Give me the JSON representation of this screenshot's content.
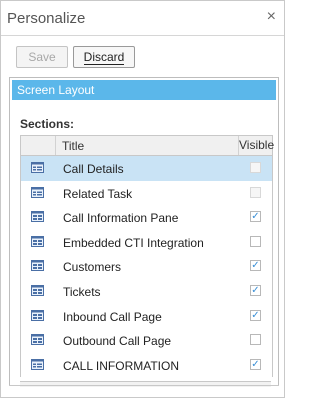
{
  "header": {
    "title": "Personalize",
    "close_glyph": "×"
  },
  "toolbar": {
    "save_label": "Save",
    "discard_label": "Discard"
  },
  "screen_layout": {
    "label": "Screen Layout"
  },
  "sections": {
    "label": "Sections:",
    "columns": {
      "title": "Title",
      "visible": "Visible"
    },
    "rows": [
      {
        "title": "Call Details",
        "icon": "single-panel-icon",
        "checked": false,
        "enabled": false,
        "selected": true
      },
      {
        "title": "Related Task",
        "icon": "single-panel-icon",
        "checked": false,
        "enabled": false,
        "selected": false
      },
      {
        "title": "Call Information Pane",
        "icon": "grid-panel-icon",
        "checked": true,
        "enabled": true,
        "selected": false
      },
      {
        "title": "Embedded CTI Integration",
        "icon": "grid-panel-icon",
        "checked": false,
        "enabled": true,
        "selected": false
      },
      {
        "title": "Customers",
        "icon": "grid-panel-icon",
        "checked": true,
        "enabled": true,
        "selected": false
      },
      {
        "title": "Tickets",
        "icon": "grid-panel-icon",
        "checked": true,
        "enabled": true,
        "selected": false
      },
      {
        "title": "Inbound Call Page",
        "icon": "grid-panel-icon",
        "checked": true,
        "enabled": true,
        "selected": false
      },
      {
        "title": "Outbound Call Page",
        "icon": "grid-panel-icon",
        "checked": false,
        "enabled": true,
        "selected": false
      },
      {
        "title": "CALL INFORMATION",
        "icon": "single-panel-icon",
        "checked": true,
        "enabled": true,
        "selected": false
      }
    ]
  },
  "colors": {
    "accent": "#5bb7ea",
    "selected_row": "#c9e3f5",
    "check": "#3a8fd6",
    "icon": "#4a6fa5"
  }
}
